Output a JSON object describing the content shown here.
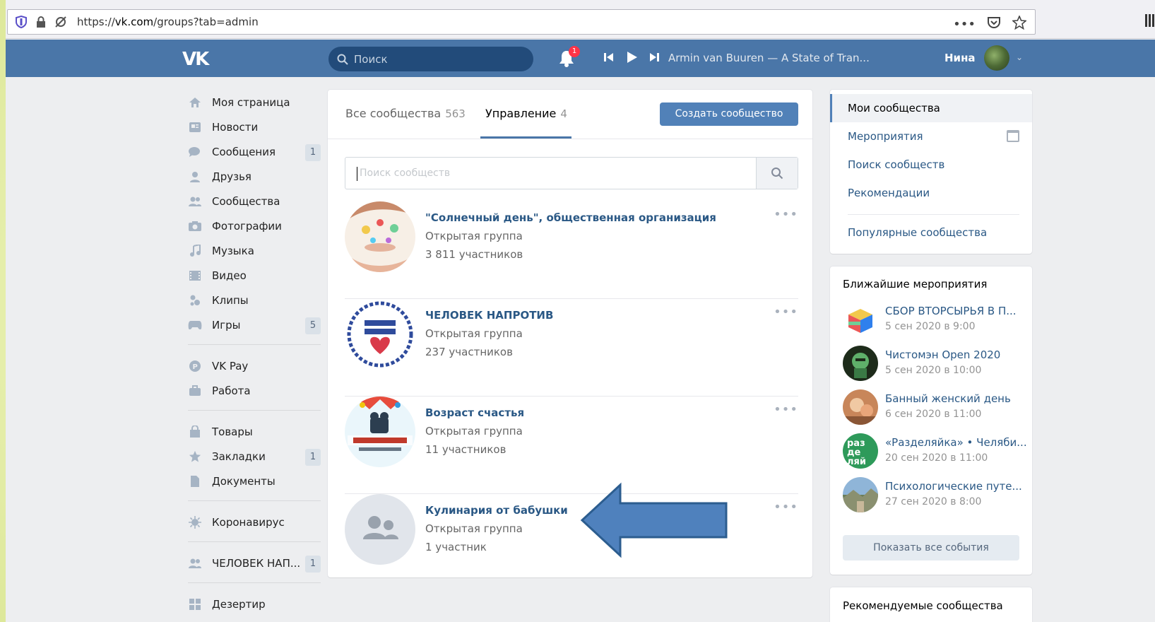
{
  "browser": {
    "url_prefix": "https://",
    "url_domain": "vk.com",
    "url_path": "/groups?tab=admin"
  },
  "header": {
    "logo": "VK",
    "search_placeholder": "Поиск",
    "notifications_count": "1",
    "now_playing": "Armin van Buuren — A State of Tran...",
    "user_name": "Нина"
  },
  "sidebar": {
    "items": [
      {
        "label": "Моя страница",
        "icon": "home-icon",
        "count": ""
      },
      {
        "label": "Новости",
        "icon": "news-icon",
        "count": ""
      },
      {
        "label": "Сообщения",
        "icon": "messages-icon",
        "count": "1"
      },
      {
        "label": "Друзья",
        "icon": "friends-icon",
        "count": ""
      },
      {
        "label": "Сообщества",
        "icon": "communities-icon",
        "count": ""
      },
      {
        "label": "Фотографии",
        "icon": "camera-icon",
        "count": ""
      },
      {
        "label": "Музыка",
        "icon": "music-icon",
        "count": ""
      },
      {
        "label": "Видео",
        "icon": "video-icon",
        "count": ""
      },
      {
        "label": "Клипы",
        "icon": "clips-icon",
        "count": ""
      },
      {
        "label": "Игры",
        "icon": "gamepad-icon",
        "count": "5"
      },
      {
        "label": "VK Pay",
        "icon": "vkpay-icon",
        "count": ""
      },
      {
        "label": "Работа",
        "icon": "briefcase-icon",
        "count": ""
      },
      {
        "label": "Товары",
        "icon": "shopping-bag-icon",
        "count": ""
      },
      {
        "label": "Закладки",
        "icon": "star-icon",
        "count": "1"
      },
      {
        "label": "Документы",
        "icon": "document-icon",
        "count": ""
      },
      {
        "label": "Коронавирус",
        "icon": "virus-icon",
        "count": ""
      },
      {
        "label": "ЧЕЛОВЕК НАП...",
        "icon": "group-icon",
        "count": "1"
      },
      {
        "label": "Дезертир",
        "icon": "apps-icon",
        "count": ""
      }
    ]
  },
  "main": {
    "tabs": [
      {
        "label": "Все сообщества",
        "count": "563"
      },
      {
        "label": "Управление",
        "count": "4"
      }
    ],
    "create_button": "Создать сообщество",
    "search_placeholder": "Поиск сообществ",
    "groups": [
      {
        "name": "\"Солнечный день\", общественная организация",
        "type": "Открытая группа",
        "members": "3 811 участников"
      },
      {
        "name": "ЧЕЛОВЕК НАПРОТИВ",
        "type": "Открытая группа",
        "members": "237 участников"
      },
      {
        "name": "Возраст счастья",
        "type": "Открытая группа",
        "members": "11 участников"
      },
      {
        "name": "Кулинария от бабушки",
        "type": "Открытая группа",
        "members": "1 участник"
      }
    ],
    "more_label": "•••"
  },
  "right_menu": {
    "items": [
      "Мои сообщества",
      "Мероприятия",
      "Поиск сообществ",
      "Рекомендации",
      "Популярные сообщества"
    ]
  },
  "events": {
    "title": "Ближайшие мероприятия",
    "items": [
      {
        "name": "СБОР ВТОРСЫРЬЯ В П...",
        "date": "5 сен 2020 в 9:00"
      },
      {
        "name": "Чистомэн Open 2020",
        "date": "5 сен 2020 в 10:00"
      },
      {
        "name": "Банный женский день",
        "date": "6 сен 2020 в 11:00"
      },
      {
        "name": "«Разделяйка» • Челяби...",
        "date": "20 сен 2020 в 11:00"
      },
      {
        "name": "Психологические путе...",
        "date": "27 сен 2020 в 8:00"
      }
    ],
    "show_all": "Показать все события"
  },
  "recommended": {
    "title": "Рекомендуемые сообщества"
  },
  "colors": {
    "header_bg": "#4a76a8",
    "link": "#2a5885",
    "button": "#5181b8",
    "arrow_fill": "#4f81bd",
    "arrow_stroke": "#2c5d8f"
  }
}
